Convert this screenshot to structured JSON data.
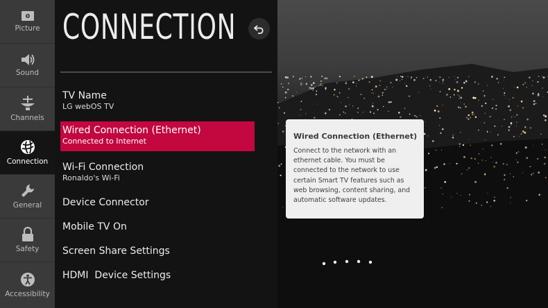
{
  "sidebar": {
    "items": [
      {
        "label": "Picture",
        "icon": "picture-icon",
        "active": false
      },
      {
        "label": "Sound",
        "icon": "speaker-icon",
        "active": false
      },
      {
        "label": "Channels",
        "icon": "antenna-icon",
        "active": false
      },
      {
        "label": "Connection",
        "icon": "globe-icon",
        "active": true
      },
      {
        "label": "General",
        "icon": "wrench-icon",
        "active": false
      },
      {
        "label": "Safety",
        "icon": "lock-icon",
        "active": false
      },
      {
        "label": "Accessibility",
        "icon": "accessibility-icon",
        "active": false
      }
    ]
  },
  "panel": {
    "title": "CONNECTION",
    "back_icon": "back-arrow-icon",
    "items": [
      {
        "label": "TV Name",
        "sub": "LG webOS TV"
      },
      {
        "label": "Wired Connection (Ethernet)",
        "sub": "Connected to Internet"
      },
      {
        "label": "Wi-Fi Connection",
        "sub": "Ronaldo's Wi-Fi"
      },
      {
        "label": "Device Connector",
        "sub": ""
      },
      {
        "label": "Mobile TV On",
        "sub": ""
      },
      {
        "label": "Screen Share Settings",
        "sub": ""
      },
      {
        "label": "HDMI  Device Settings",
        "sub": ""
      }
    ]
  },
  "tooltip": {
    "title": "Wired Connection (Ethernet)",
    "body": "Connect to the network with an ethernet cable. You must be connected to the network to use certain Smart TV features such as web browsing, content sharing, and automatic software updates."
  },
  "colors": {
    "accent": "#c3073f",
    "rail": "#3a3a3a",
    "panel": "#131313"
  }
}
